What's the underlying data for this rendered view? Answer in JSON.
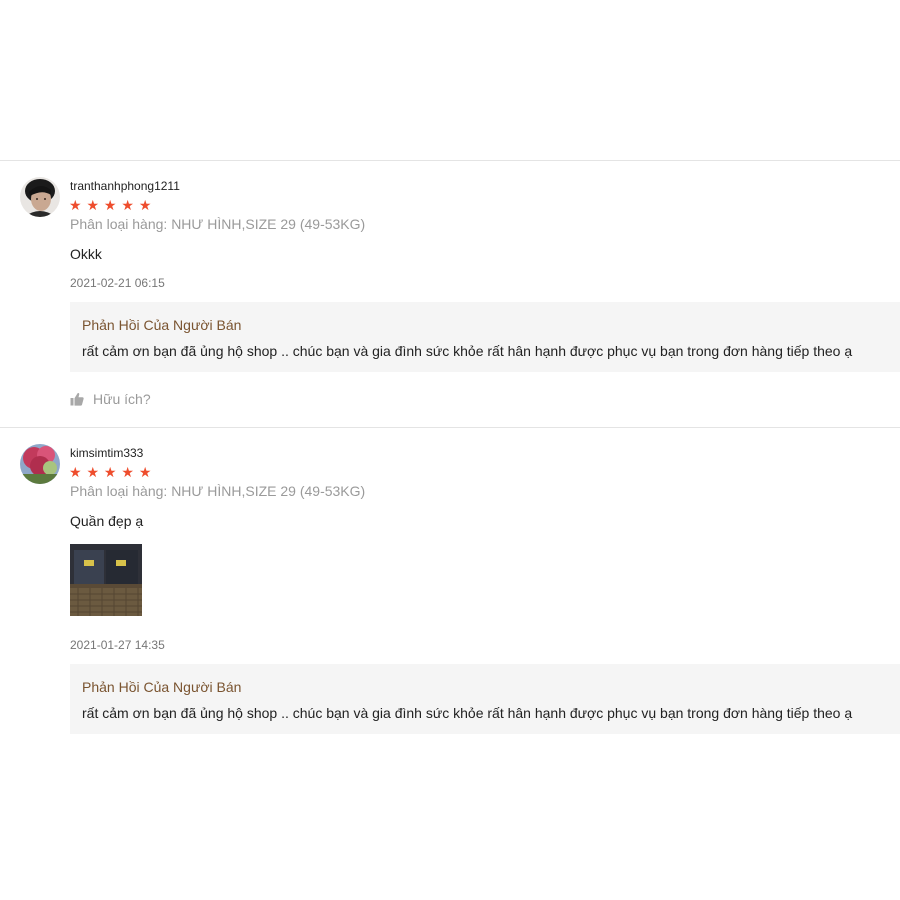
{
  "colors": {
    "star": "#ee4d2d",
    "seller_reply_title": "#7a5430",
    "reply_background": "#f5f5f5",
    "muted_text": "#9a9a9a"
  },
  "reviews": [
    {
      "username": "tranthanhphong1211",
      "avatar": "user-avatar-photo",
      "rating": 5,
      "stars": [
        "★",
        "★",
        "★",
        "★",
        "★"
      ],
      "variation": "Phân loại hàng: NHƯ HÌNH,SIZE 29 (49-53KG)",
      "comment": "Okkk",
      "timestamp": "2021-02-21 06:15",
      "seller_reply": {
        "title": "Phản Hồi Của Người Bán",
        "text": "rất cảm ơn bạn đã ủng hộ shop .. chúc bạn và gia đình sức khỏe rất hân hạnh được phục vụ bạn trong đơn hàng tiếp theo ạ"
      },
      "helpful_label": "Hữu ích?",
      "helpful_icon": "thumbs-up-icon"
    },
    {
      "username": "kimsimtim333",
      "avatar": "user-avatar-photo",
      "rating": 5,
      "stars": [
        "★",
        "★",
        "★",
        "★",
        "★"
      ],
      "variation": "Phân loại hàng: NHƯ HÌNH,SIZE 29 (49-53KG)",
      "comment": "Quần đẹp ạ",
      "photos": [
        "review-photo-jeans"
      ],
      "timestamp": "2021-01-27 14:35",
      "seller_reply": {
        "title": "Phản Hồi Của Người Bán",
        "text": "rất cảm ơn bạn đã ủng hộ shop .. chúc bạn và gia đình sức khỏe rất hân hạnh được phục vụ bạn trong đơn hàng tiếp theo ạ"
      }
    }
  ]
}
